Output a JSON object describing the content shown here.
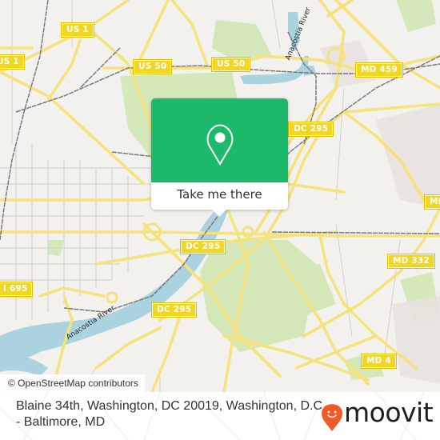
{
  "map": {
    "attribution": "© OpenStreetMap contributors",
    "road_shields": [
      {
        "label": "US 1"
      },
      {
        "label": "US 1"
      },
      {
        "label": "US 50"
      },
      {
        "label": "US 50"
      },
      {
        "label": "MD 459"
      },
      {
        "label": "DC 295"
      },
      {
        "label": "DC 295"
      },
      {
        "label": "DC 295"
      },
      {
        "label": "I 695"
      },
      {
        "label": "MD 332"
      },
      {
        "label": "MD 4"
      },
      {
        "label": "MD"
      }
    ],
    "water_labels": [
      {
        "label": "Anacostia River"
      },
      {
        "label": "Anacostia River"
      }
    ],
    "colors": {
      "land": "#f2f1ee",
      "park": "#cfe6b0",
      "water": "#aad3df",
      "road": "#f6e27a",
      "rail": "#7a7a7a"
    }
  },
  "popup": {
    "icon": "map-pin-icon",
    "button_label": "Take me there",
    "accent_color": "#1db96a"
  },
  "footer": {
    "address": "Blaine 34th, Washington, DC 20019, Washington, D.C. - Baltimore, MD",
    "brand": "moovit",
    "brand_color": "#f05a28"
  }
}
